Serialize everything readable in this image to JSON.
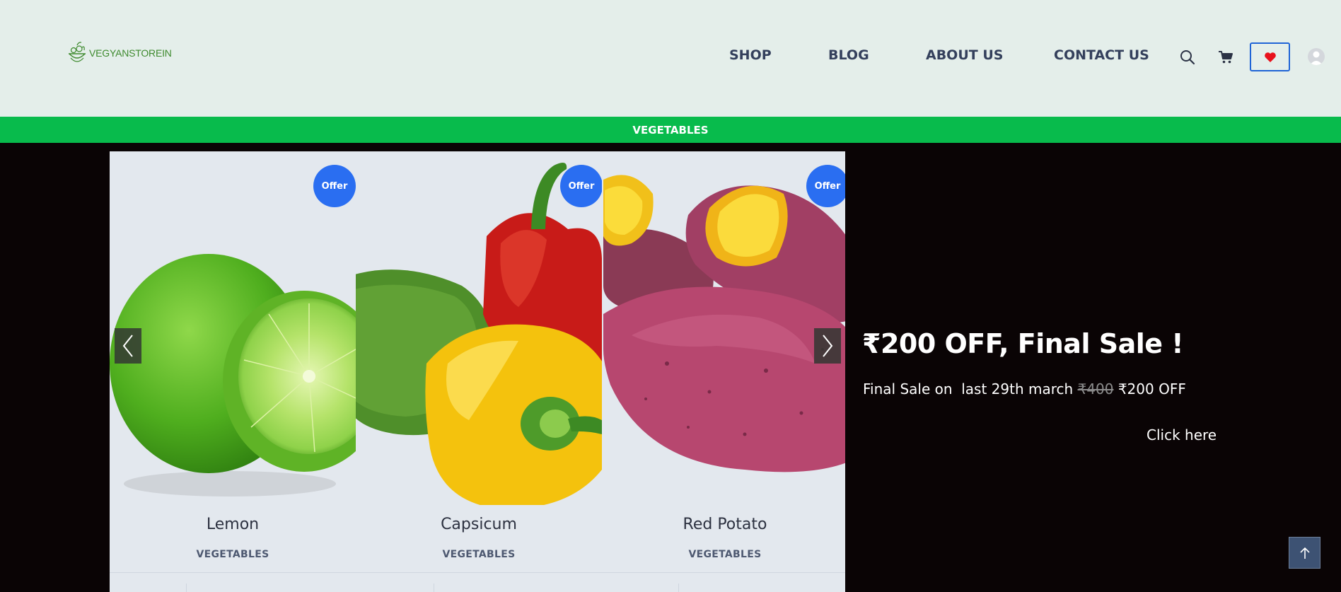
{
  "header": {
    "logo_text": "VEGYANSTOREIN",
    "nav": [
      {
        "label": "SHOP"
      },
      {
        "label": "BLOG"
      },
      {
        "label": "ABOUT US"
      },
      {
        "label": "CONTACT US"
      }
    ],
    "icons": [
      "search-icon",
      "cart-icon",
      "heart-icon",
      "user-icon"
    ]
  },
  "category_bar": {
    "label": "VEGETABLES"
  },
  "carousel": {
    "cards": [
      {
        "name": "Lemon",
        "category": "VEGETABLES",
        "badge": "Offer"
      },
      {
        "name": "Capsicum",
        "category": "VEGETABLES",
        "badge": "Offer"
      },
      {
        "name": "Red Potato",
        "category": "VEGETABLES",
        "badge": "Offer"
      }
    ]
  },
  "promo": {
    "title": "₹200 OFF, Final Sale !",
    "line_prefix": "Final Sale on  last 29th march ",
    "old_price": "₹400",
    "line_suffix": " ₹200 OFF",
    "cta": "Click here"
  },
  "colors": {
    "header_bg": "#e4eeea",
    "category_bar": "#08bb4c",
    "offer_badge": "#2a6ef1",
    "nav_text": "#34405c",
    "page_bg": "#0a0405",
    "wishlist_border": "#1f64d6",
    "heart": "#e8111c"
  }
}
